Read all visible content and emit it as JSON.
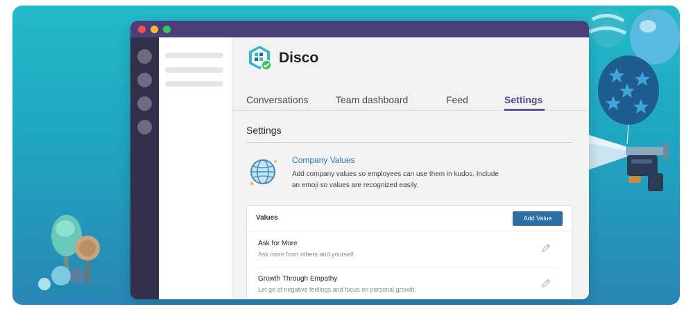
{
  "app": {
    "name": "Disco"
  },
  "tabs": [
    {
      "label": "Conversations",
      "active": false
    },
    {
      "label": "Team dashboard",
      "active": false
    },
    {
      "label": "Feed",
      "active": false
    },
    {
      "label": "Settings",
      "active": true
    }
  ],
  "page": {
    "title": "Settings"
  },
  "company_values": {
    "title": "Company Values",
    "description": "Add company values so employees can use them in kudos. Include an emoji so values are recognized easily."
  },
  "values_card": {
    "title": "Values",
    "add_button": "Add Value",
    "items": [
      {
        "name": "Ask for More",
        "description": "Ask more from others and yourself."
      },
      {
        "name": "Growth Through Empathy",
        "description": "Let go of negative feelings and focus on personal growth."
      }
    ]
  },
  "icons": {
    "logo": "disco-logo-icon",
    "company_values": "globe-icon",
    "edit": "pencil-icon"
  },
  "colors": {
    "titlebar": "#4a3f78",
    "rail": "#332e49",
    "accent": "#5a559a",
    "link": "#2b79b0",
    "button": "#2e6fa3",
    "background_gradient_top": "#23b9c9",
    "background_gradient_bottom": "#2a86b6"
  }
}
